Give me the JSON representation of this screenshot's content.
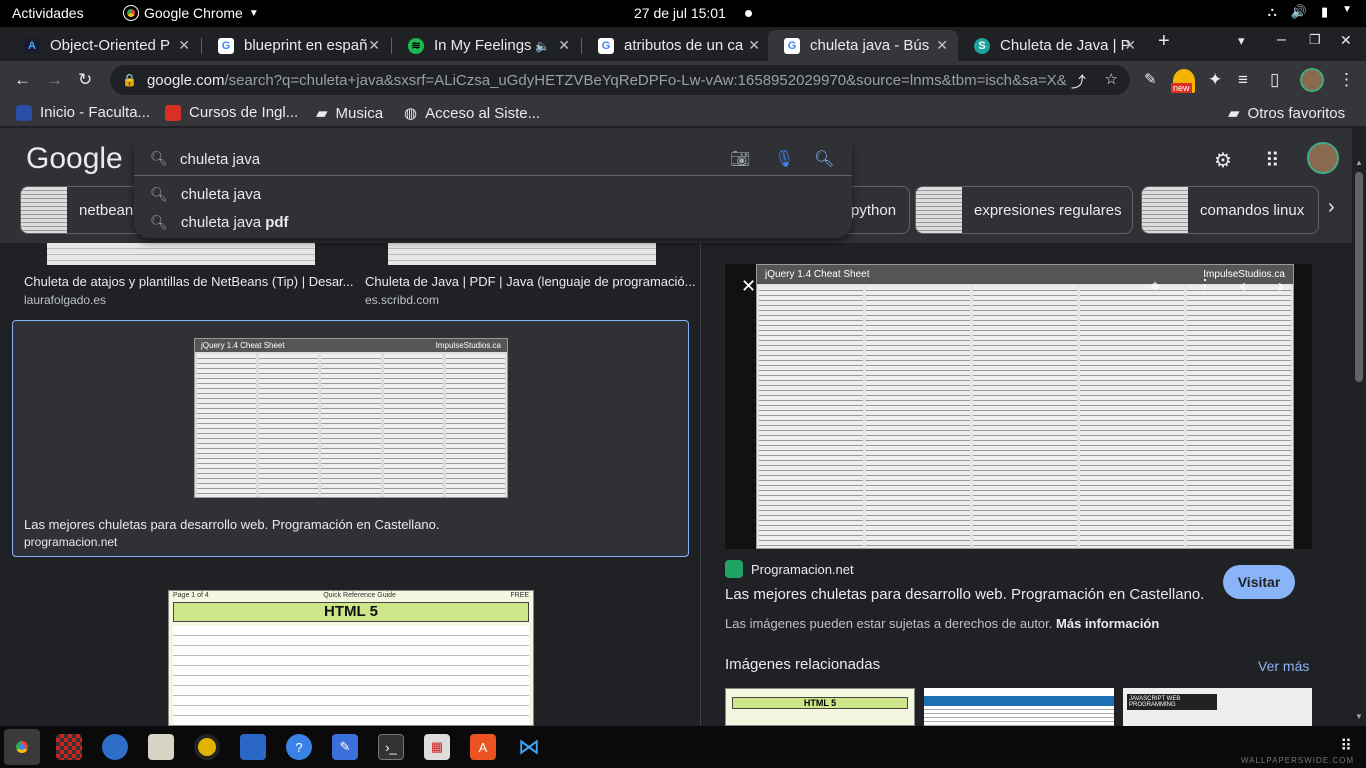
{
  "system": {
    "activities": "Actividades",
    "app_name": "Google Chrome",
    "clock": "27 de jul  15:01"
  },
  "tabs": [
    {
      "label": "Object-Oriented P",
      "color": "#1a1a2e"
    },
    {
      "label": "blueprint en españ",
      "color": "#4285f4"
    },
    {
      "label": "In My Feelings -",
      "color": "#1db954"
    },
    {
      "label": "atributos de un ca",
      "color": "#4285f4"
    },
    {
      "label": "chuleta java - Bús",
      "color": "#4285f4"
    },
    {
      "label": "Chuleta de Java | P",
      "color": "#1ba39c"
    }
  ],
  "address": {
    "host": "google.com",
    "path": "/search?q=chuleta+java&sxsrf=ALiCzsa_uGdyHETZVBeYqReDPFo-Lw-vAw:1658952029970&source=lnms&tbm=isch&sa=X&ved=2ah...",
    "new_badge": "new"
  },
  "bookmarks": [
    {
      "label": "Inicio - Faculta...",
      "color": "#2a4fa8"
    },
    {
      "label": "Cursos de Ingl...",
      "color": "#d93025"
    },
    {
      "label": "Musica",
      "color": "#e8eaed"
    },
    {
      "label": "Acceso al Siste...",
      "color": "#e8eaed"
    },
    {
      "label": "Otros favoritos",
      "color": "#e8eaed"
    }
  ],
  "google": {
    "logo": "Google",
    "query": "chuleta java",
    "suggestions": [
      {
        "main": "chuleta java",
        "bold": ""
      },
      {
        "main": "chuleta java ",
        "bold": "pdf"
      }
    ]
  },
  "chips": [
    {
      "label": "netbeans"
    },
    {
      "label": "python"
    },
    {
      "label": "expresiones regulares"
    },
    {
      "label": "comandos linux"
    }
  ],
  "results": [
    {
      "title": "Chuleta de atajos y plantillas de NetBeans (Tip) | Desar...",
      "source": "laurafolgado.es"
    },
    {
      "title": "Chuleta de Java | PDF | Java (lenguaje de programació...",
      "source": "es.scribd.com"
    },
    {
      "title": "Las mejores chuletas para desarrollo web. Programación en Castellano.",
      "source": "programacion.net",
      "thumb_title": "jQuery 1.4 Cheat Sheet",
      "thumb_brand": "ImpulseStudios.ca"
    },
    {
      "thumb_header": "Page 1 of 4",
      "thumb_guide": "Quick Reference Guide",
      "thumb_free": "FREE",
      "thumb_title": "HTML 5"
    }
  ],
  "preview": {
    "sheet_title": "jQuery 1.4 Cheat Sheet",
    "sheet_brand": "ImpulseStudios.ca",
    "site": "Programacion.net",
    "title": "Las mejores chuletas para desarrollo web. Programación en Castellano.",
    "visit": "Visitar",
    "note": "Las imágenes pueden estar sujetas a derechos de autor.",
    "note_link": "Más información",
    "related": "Imágenes relacionadas",
    "more": "Ver más",
    "related_html5": "HTML 5",
    "related_js": "JAVASCRIPT WEB PROGRAMMING"
  },
  "taskbar": {
    "watermark": "WALLPAPERSWIDE.COM"
  }
}
